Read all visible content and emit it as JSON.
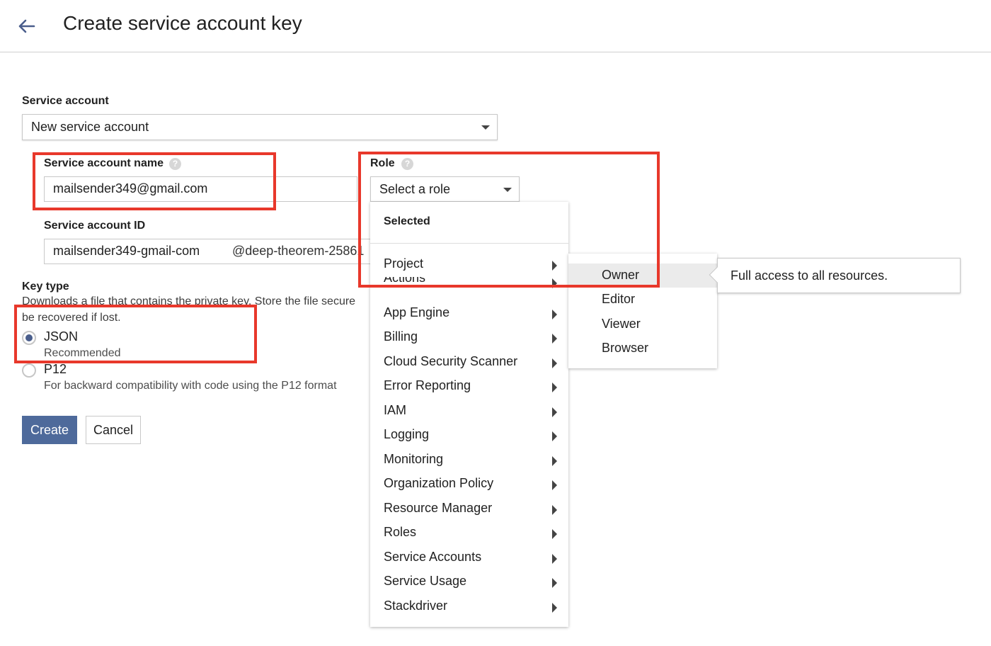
{
  "header": {
    "title": "Create service account key"
  },
  "form": {
    "service_account_label": "Service account",
    "service_account_value": "New service account",
    "service_account_name_label": "Service account name",
    "service_account_name_value": "mailsender349@gmail.com",
    "role_label": "Role",
    "role_value": "Select a role",
    "service_account_id_label": "Service account ID",
    "service_account_id_value": "mailsender349-gmail-com",
    "service_account_id_suffix": "@deep-theorem-25861",
    "help_glyph": "?"
  },
  "key_type": {
    "label": "Key type",
    "description_line1": "Downloads a file that contains the private key. Store the file secure",
    "description_line2": "be recovered if lost.",
    "options": [
      {
        "label": "JSON",
        "sublabel": "Recommended",
        "selected": true
      },
      {
        "label": "P12",
        "sublabel": "For backward compatibility with code using the P12 format",
        "selected": false
      }
    ]
  },
  "buttons": {
    "create": "Create",
    "cancel": "Cancel"
  },
  "role_menu": {
    "header": "Selected",
    "items": [
      "Project",
      "Actions",
      "App Engine",
      "Billing",
      "Cloud Security Scanner",
      "Error Reporting",
      "IAM",
      "Logging",
      "Monitoring",
      "Organization Policy",
      "Resource Manager",
      "Roles",
      "Service Accounts",
      "Service Usage",
      "Stackdriver"
    ]
  },
  "project_submenu": {
    "items": [
      "Owner",
      "Editor",
      "Viewer",
      "Browser"
    ],
    "highlighted": "Owner"
  },
  "tooltip": {
    "text": "Full access to all resources."
  },
  "colors": {
    "primary_button": "#4e6a9b",
    "highlight_box": "#e8382b",
    "radio_selected": "#4a5e8c"
  }
}
